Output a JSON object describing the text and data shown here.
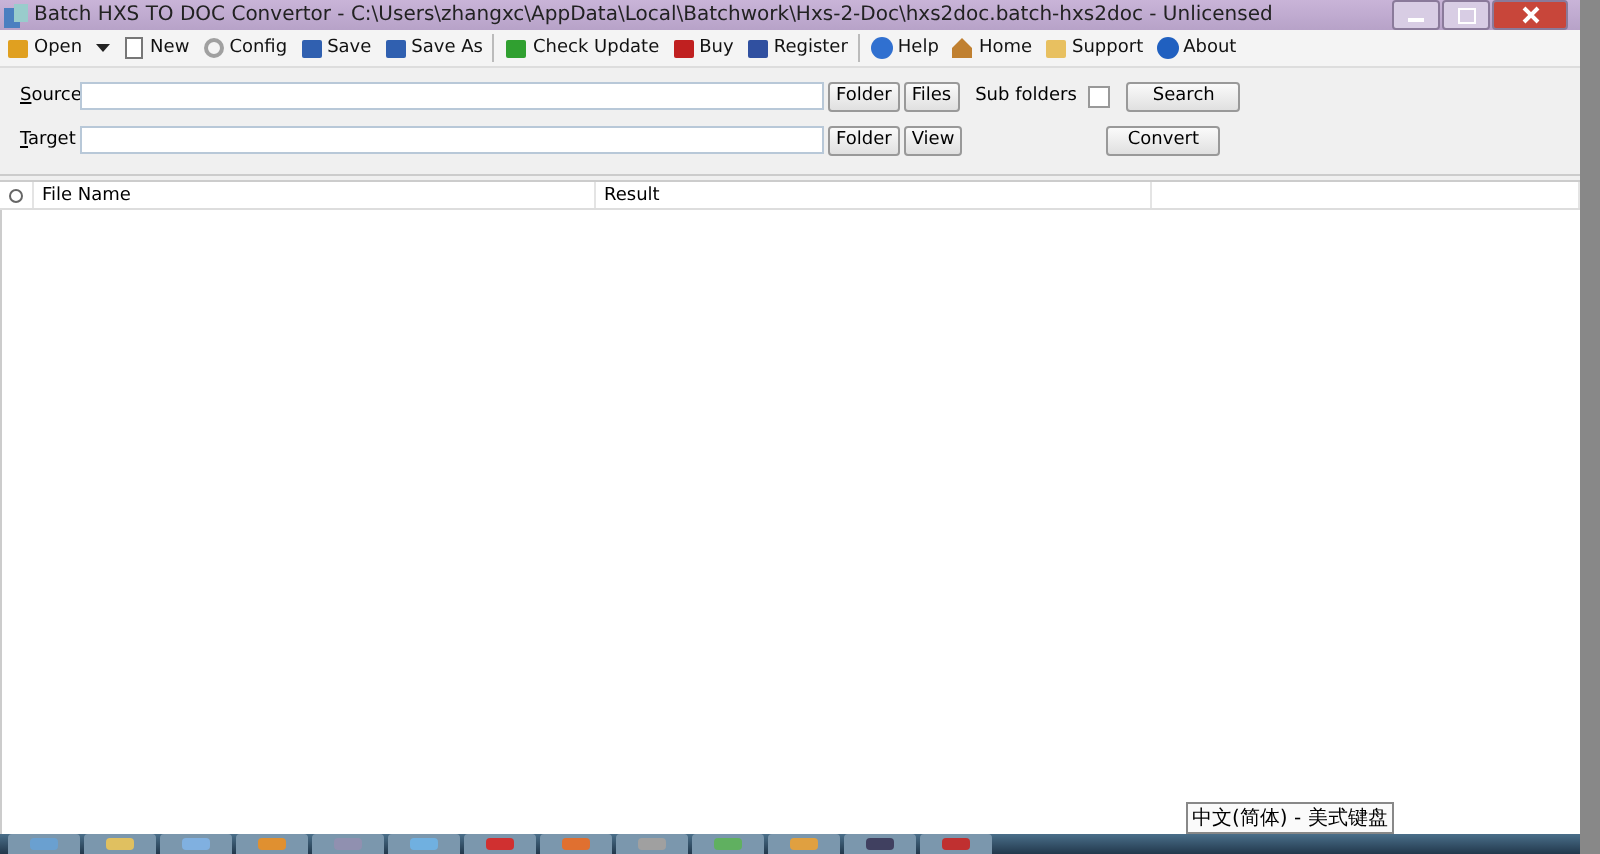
{
  "window": {
    "title": "Batch HXS TO DOC Convertor - C:\\Users\\zhangxc\\AppData\\Local\\Batchwork\\Hxs-2-Doc\\hxs2doc.batch-hxs2doc - Unlicensed"
  },
  "toolbar_groups": [
    [
      {
        "label": "Open",
        "kind": "dropdown"
      },
      {
        "label": "New",
        "kind": "button"
      },
      {
        "label": "Config",
        "kind": "button"
      },
      {
        "label": "Save",
        "kind": "button"
      },
      {
        "label": "Save As",
        "kind": "button"
      }
    ],
    [
      {
        "label": "Check Update",
        "kind": "button"
      },
      {
        "label": "Buy",
        "kind": "button"
      },
      {
        "label": "Register",
        "kind": "button"
      }
    ],
    [
      {
        "label": "Help",
        "kind": "button"
      },
      {
        "label": "Home",
        "kind": "button"
      },
      {
        "label": "Support",
        "kind": "button"
      },
      {
        "label": "About",
        "kind": "button"
      }
    ]
  ],
  "source": {
    "label": "Source",
    "buttons": [
      "Folder",
      "Files"
    ],
    "subfolders_label": "Sub folders",
    "subfolders_checked": false,
    "action": "Search"
  },
  "target": {
    "label": "Target",
    "buttons": [
      "Folder",
      "View"
    ],
    "action": "Convert"
  },
  "table": {
    "columns": [
      "File Name",
      "Result"
    ]
  },
  "ime_tooltip": "中文(简体) - 美式键盘"
}
